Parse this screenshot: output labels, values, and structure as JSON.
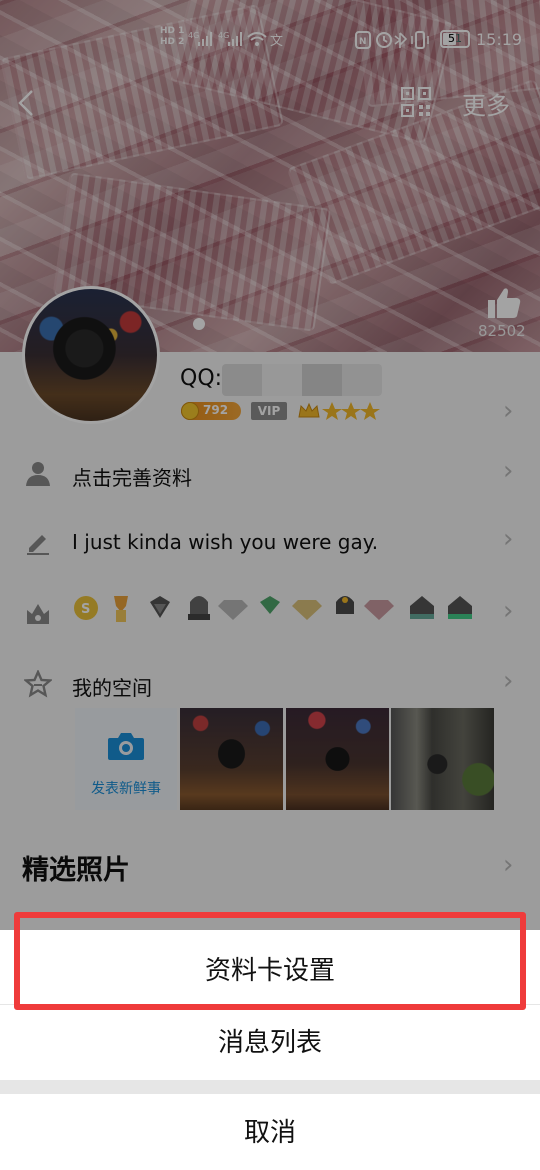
{
  "status_bar": {
    "time": "15:19",
    "battery": "51",
    "sim1": "HD 1",
    "sim2": "HD 2",
    "net": "4G"
  },
  "header": {
    "more_label": "更多",
    "like_count": "82502"
  },
  "profile": {
    "qq_label": "QQ:",
    "level_badge": "792",
    "vip_label": "VIP"
  },
  "rows": {
    "complete_profile": "点击完善资料",
    "signature": "I just kinda wish you were gay.",
    "space_label": "我的空间",
    "post_new": "发表新鲜事",
    "featured_photos": "精选照片"
  },
  "sheet": {
    "profile_card_settings": "资料卡设置",
    "message_list": "消息列表",
    "cancel": "取消"
  },
  "colors": {
    "highlight_border": "#ef3b3b",
    "camera_blue": "#1a8fd8"
  }
}
